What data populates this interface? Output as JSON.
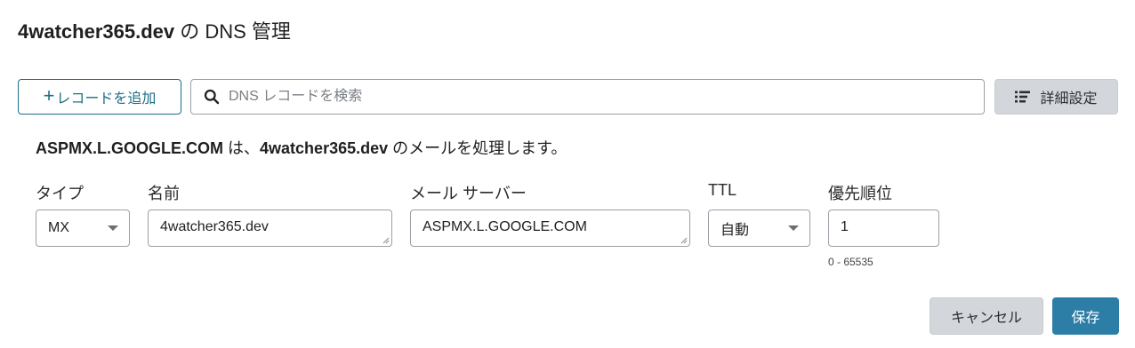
{
  "header": {
    "domain": "4watcher365.dev",
    "suffix": " の DNS 管理"
  },
  "toolbar": {
    "add_plus": "+",
    "add_label": "レコードを追加",
    "search_placeholder": "DNS レコードを検索",
    "search_icon": "search-icon",
    "advanced_icon": "list-settings-icon",
    "advanced_label": "詳細設定"
  },
  "info": {
    "server": "ASPMX.L.GOOGLE.COM",
    "part1": " は、",
    "domain": "4watcher365.dev",
    "part2": " のメールを処理します。"
  },
  "form": {
    "type": {
      "label": "タイプ",
      "value": "MX"
    },
    "name": {
      "label": "名前",
      "value": "4watcher365.dev"
    },
    "mail_server": {
      "label": "メール サーバー",
      "value": "ASPMX.L.GOOGLE.COM"
    },
    "ttl": {
      "label": "TTL",
      "value": "自動"
    },
    "priority": {
      "label": "優先順位",
      "value": "1",
      "hint": "0 - 65535"
    }
  },
  "actions": {
    "cancel": "キャンセル",
    "save": "保存"
  },
  "colors": {
    "accent": "#1b6f86",
    "primary_button": "#2c7ea6",
    "secondary_button": "#d3d7db"
  }
}
